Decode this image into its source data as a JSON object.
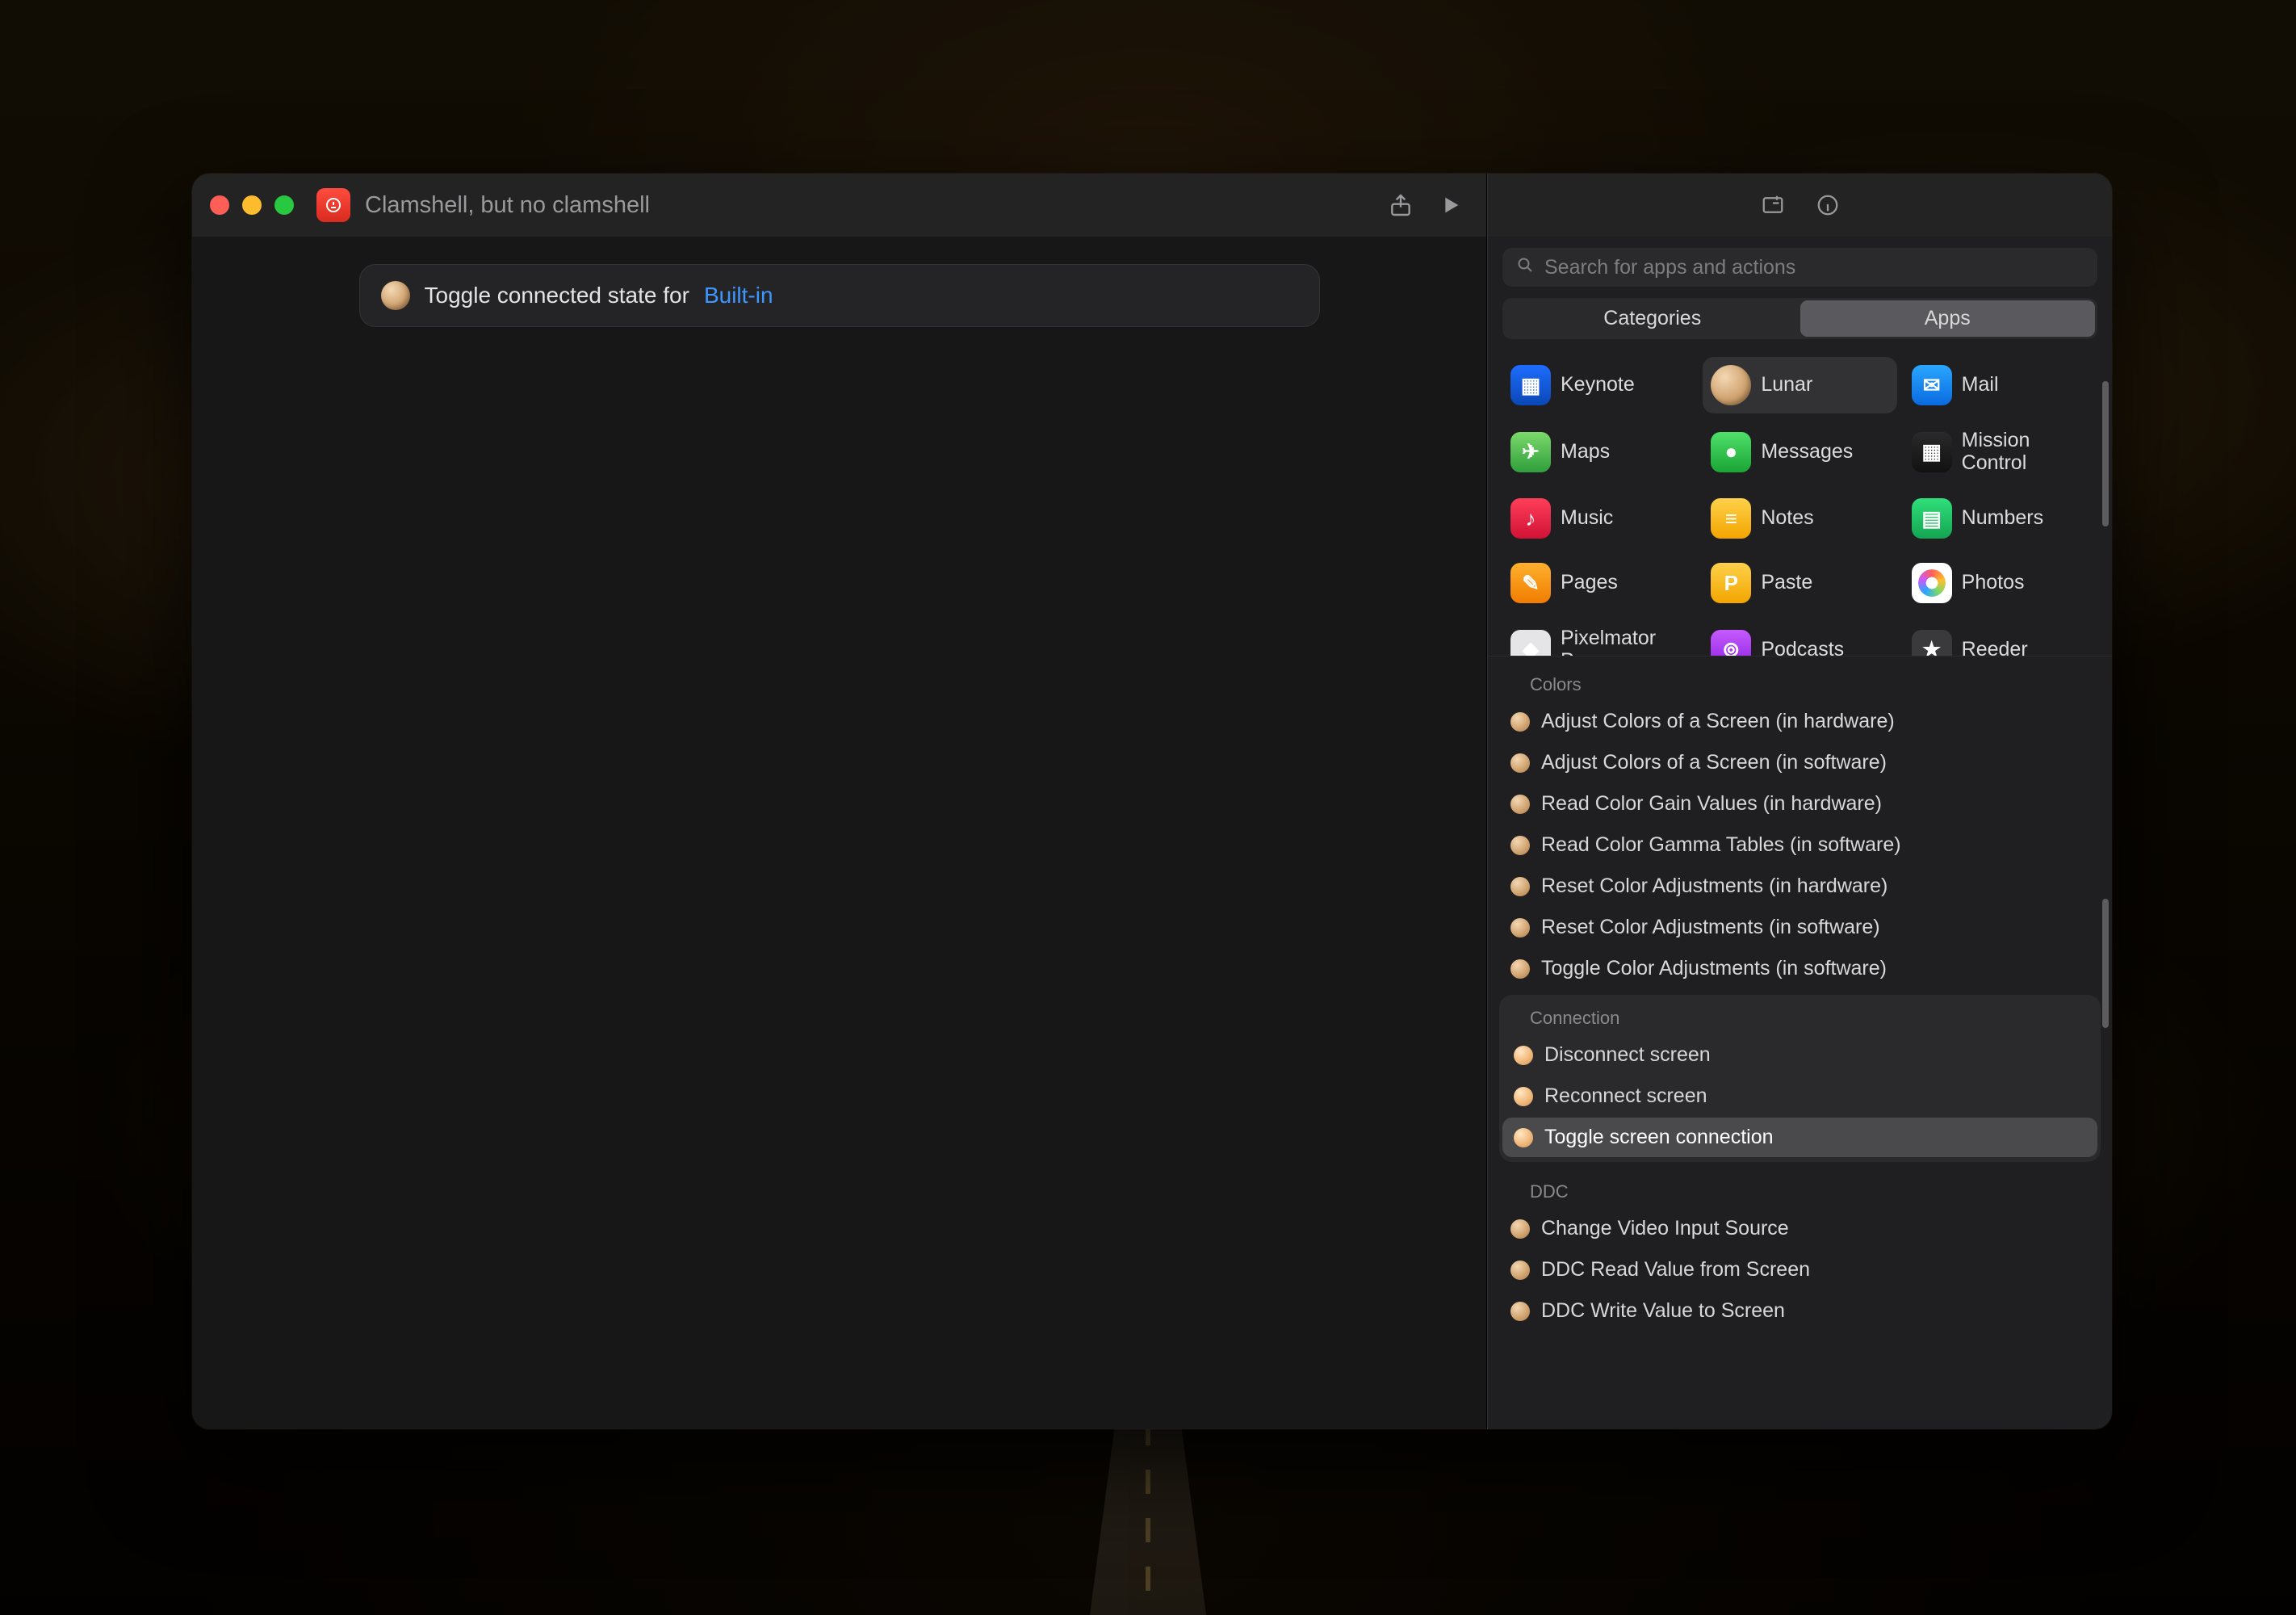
{
  "window": {
    "title": "Clamshell, but no clamshell"
  },
  "editor": {
    "action_prefix": "Toggle connected state for",
    "action_token": "Built-in"
  },
  "library": {
    "search_placeholder": "Search for apps and actions",
    "tabs": {
      "categories": "Categories",
      "apps": "Apps"
    },
    "apps": [
      {
        "name": "Keynote",
        "iconClass": "ic-keynote",
        "glyph": "▦"
      },
      {
        "name": "Lunar",
        "iconClass": "ic-lunar",
        "glyph": "",
        "selected": true,
        "orb": true
      },
      {
        "name": "Mail",
        "iconClass": "ic-mail",
        "glyph": "✉"
      },
      {
        "name": "Maps",
        "iconClass": "ic-maps",
        "glyph": "✈"
      },
      {
        "name": "Messages",
        "iconClass": "ic-messages",
        "glyph": "●"
      },
      {
        "name": "Mission Control",
        "iconClass": "ic-mission",
        "glyph": "▦"
      },
      {
        "name": "Music",
        "iconClass": "ic-music",
        "glyph": "♪"
      },
      {
        "name": "Notes",
        "iconClass": "ic-notes",
        "glyph": "≡"
      },
      {
        "name": "Numbers",
        "iconClass": "ic-numbers",
        "glyph": "▤"
      },
      {
        "name": "Pages",
        "iconClass": "ic-pages",
        "glyph": "✎"
      },
      {
        "name": "Paste",
        "iconClass": "ic-paste",
        "glyph": "P"
      },
      {
        "name": "Photos",
        "iconClass": "ic-photos",
        "glyph": "",
        "photos": true
      },
      {
        "name": "Pixelmator Pro",
        "iconClass": "ic-pixelmator",
        "glyph": "◆"
      },
      {
        "name": "Podcasts",
        "iconClass": "ic-podcasts",
        "glyph": "⊚"
      },
      {
        "name": "Reeder",
        "iconClass": "ic-reeder",
        "glyph": "★"
      }
    ],
    "sections": [
      {
        "title": "Colors",
        "highlighted": false,
        "items": [
          {
            "label": "Adjust Colors of a Screen (in hardware)"
          },
          {
            "label": "Adjust Colors of a Screen (in software)"
          },
          {
            "label": "Read Color Gain Values (in hardware)"
          },
          {
            "label": "Read Color Gamma Tables (in software)"
          },
          {
            "label": "Reset Color Adjustments (in hardware)"
          },
          {
            "label": "Reset Color Adjustments (in software)"
          },
          {
            "label": "Toggle Color Adjustments (in software)"
          }
        ]
      },
      {
        "title": "Connection",
        "highlighted": true,
        "items": [
          {
            "label": "Disconnect screen",
            "bright": true
          },
          {
            "label": "Reconnect screen",
            "bright": true
          },
          {
            "label": "Toggle screen connection",
            "bright": true,
            "selected": true
          }
        ]
      },
      {
        "title": "DDC",
        "highlighted": false,
        "items": [
          {
            "label": "Change Video Input Source"
          },
          {
            "label": "DDC Read Value from Screen"
          },
          {
            "label": "DDC Write Value to Screen"
          }
        ]
      }
    ]
  }
}
